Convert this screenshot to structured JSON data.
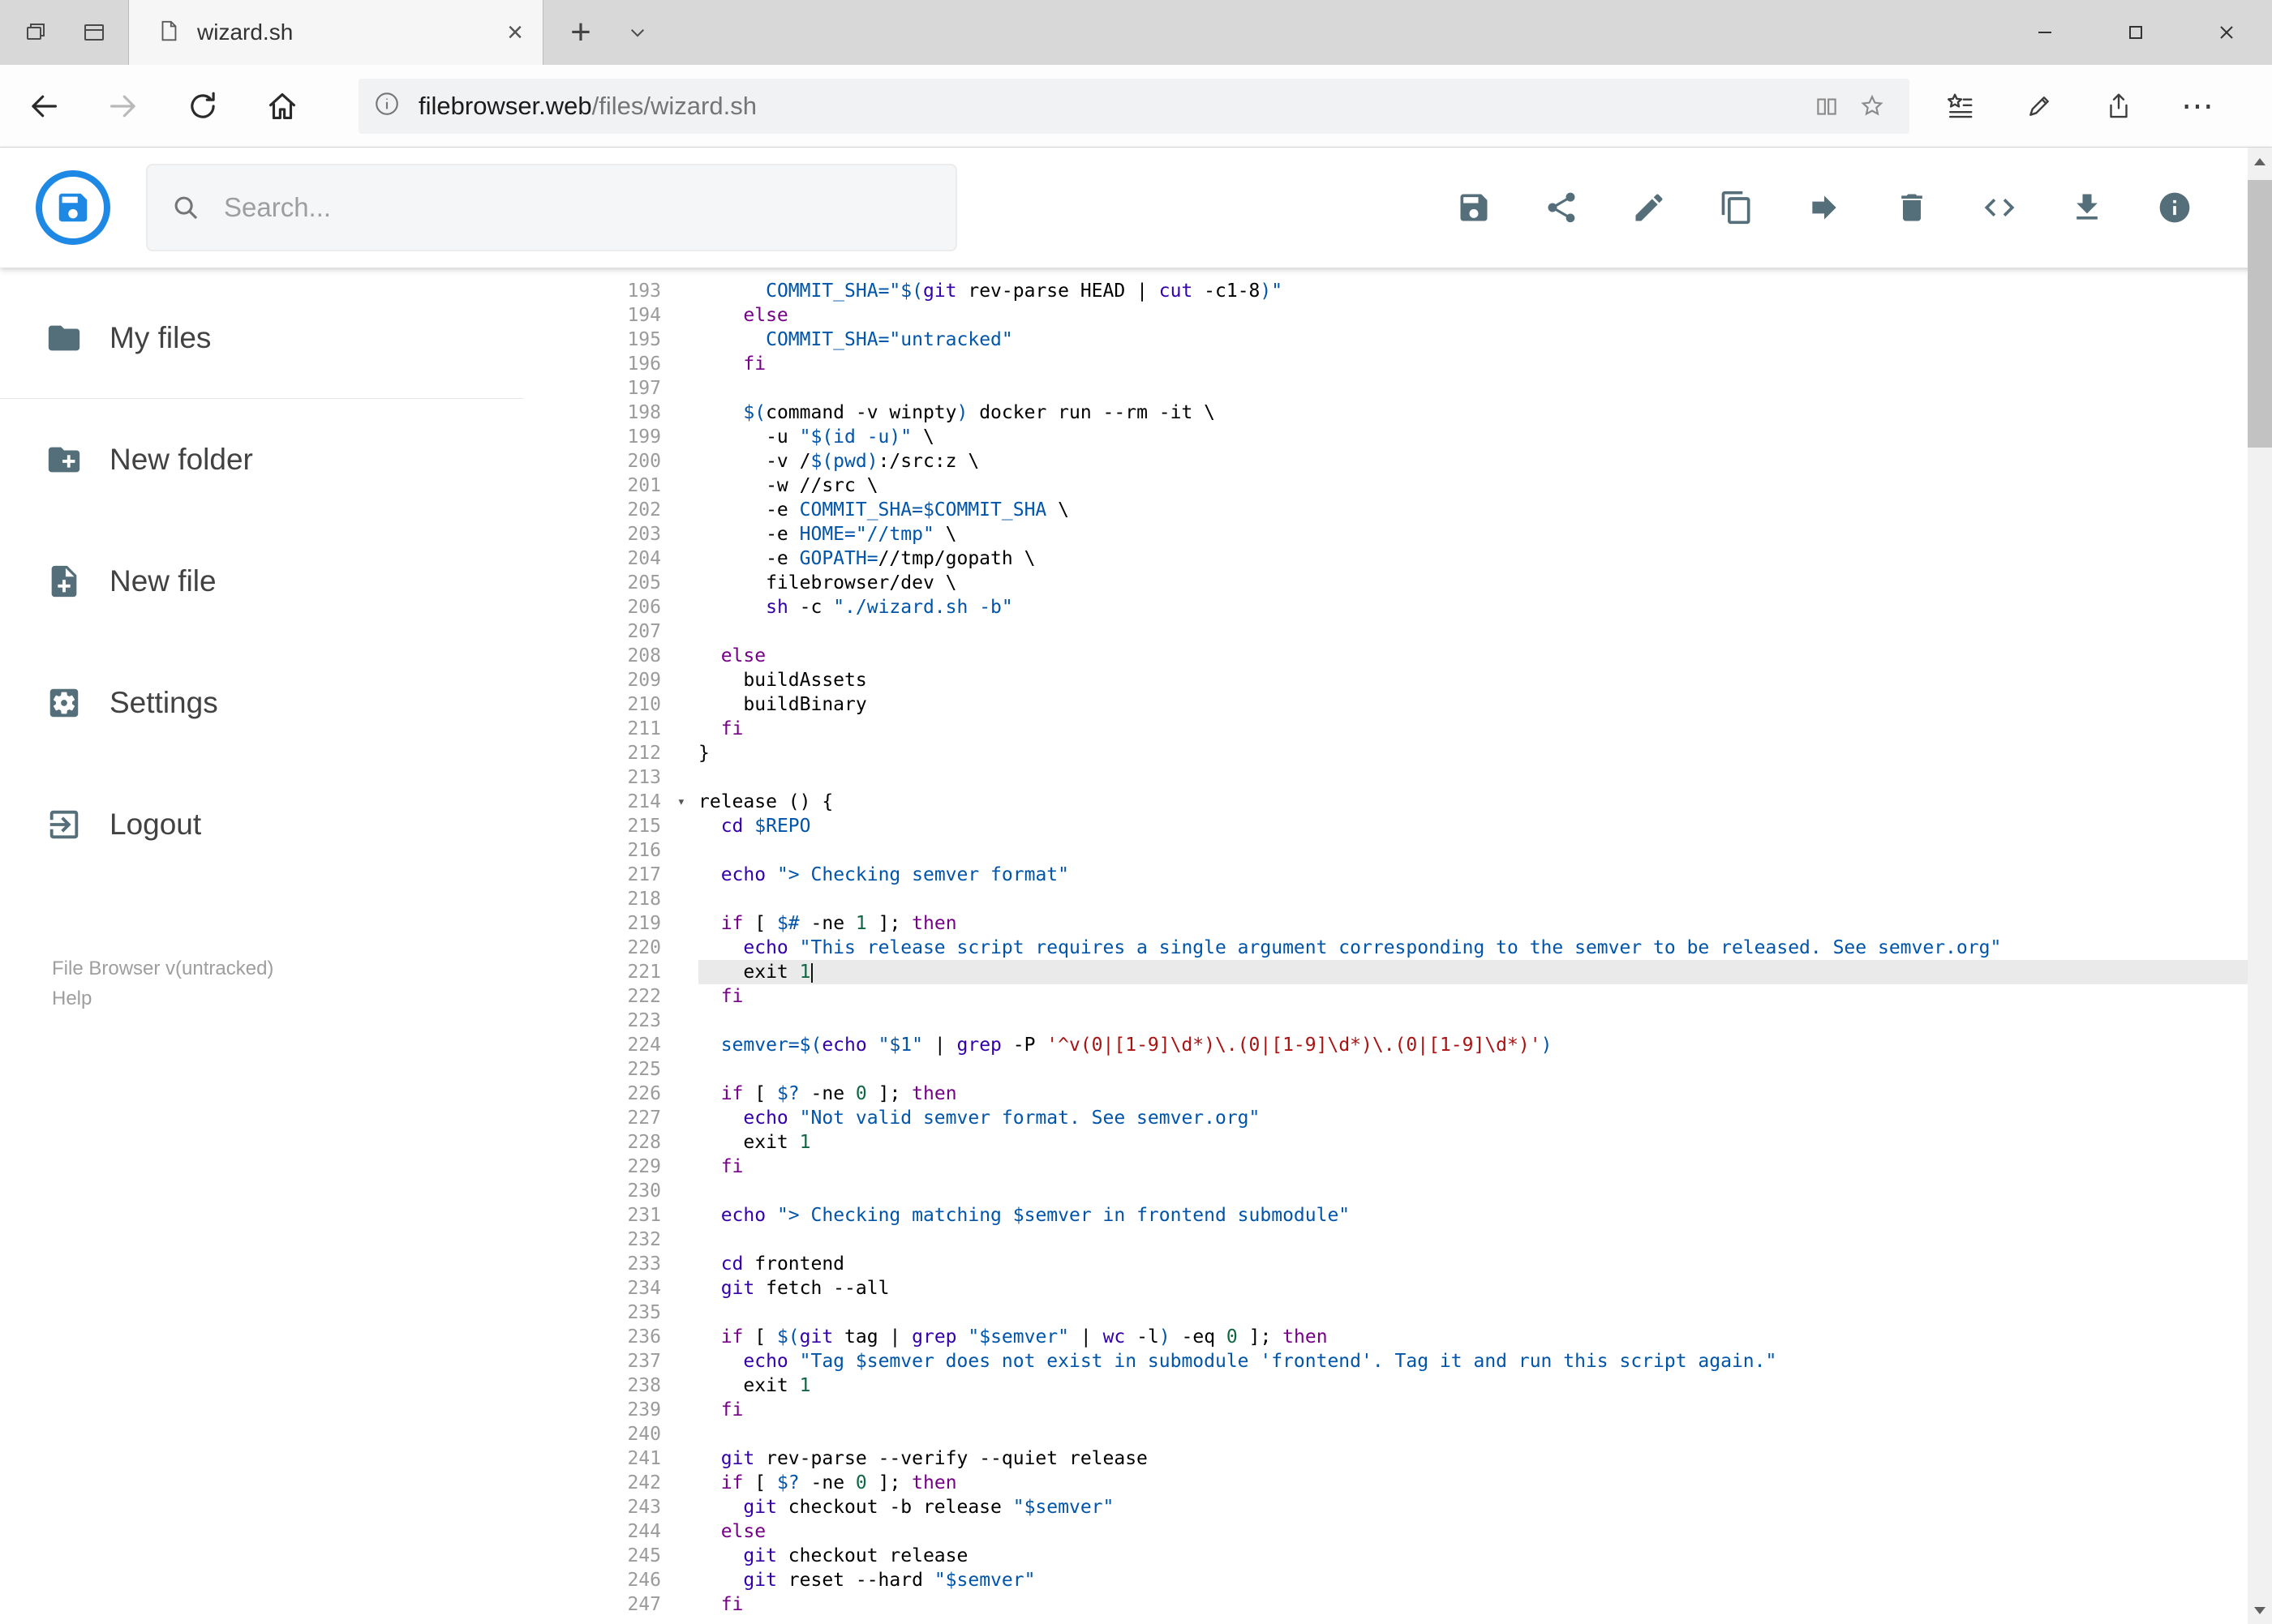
{
  "browser": {
    "tab_title": "wizard.sh",
    "url_domain": "filebrowser.web",
    "url_path": "/files/wizard.sh"
  },
  "glyphs": {
    "close_tab": "×",
    "new_tab": "+",
    "ellipsis": "⋯",
    "fold": "▾"
  },
  "theme": {
    "accent": "#1e88e5",
    "toolbar_icon": "#546e7a",
    "keyword": "#770088",
    "variable": "#0055aa",
    "builtin": "#3300aa",
    "number": "#116644",
    "string_single": "#aa1111",
    "active_line": "#eaeaea"
  },
  "app": {
    "search_placeholder": "Search...",
    "toolbar": [
      {
        "id": "save"
      },
      {
        "id": "share"
      },
      {
        "id": "rename"
      },
      {
        "id": "copy"
      },
      {
        "id": "move"
      },
      {
        "id": "delete"
      },
      {
        "id": "code"
      },
      {
        "id": "download"
      },
      {
        "id": "info"
      }
    ],
    "sidebar": [
      {
        "id": "my-files",
        "label": "My files",
        "icon": "folder"
      },
      {
        "id": "new-folder",
        "label": "New folder",
        "icon": "newfolder"
      },
      {
        "id": "new-file",
        "label": "New file",
        "icon": "newfile"
      },
      {
        "id": "settings",
        "label": "Settings",
        "icon": "settings"
      },
      {
        "id": "logout",
        "label": "Logout",
        "icon": "logout"
      }
    ],
    "footer_version": "File Browser v(untracked)",
    "footer_help": "Help"
  },
  "editor": {
    "active_line": 221,
    "fold_line": 214,
    "lines": [
      {
        "n": 193,
        "seg": [
          [
            "p",
            "      "
          ],
          [
            "v",
            "COMMIT_SHA=\"$("
          ],
          [
            "b",
            "git"
          ],
          [
            "p",
            " rev-parse HEAD | "
          ],
          [
            "b",
            "cut"
          ],
          [
            "p",
            " -c1-8"
          ],
          [
            "v",
            ")\""
          ]
        ]
      },
      {
        "n": 194,
        "seg": [
          [
            "p",
            "    "
          ],
          [
            "k",
            "else"
          ]
        ]
      },
      {
        "n": 195,
        "seg": [
          [
            "p",
            "      "
          ],
          [
            "v",
            "COMMIT_SHA=\"untracked\""
          ]
        ]
      },
      {
        "n": 196,
        "seg": [
          [
            "p",
            "    "
          ],
          [
            "k",
            "fi"
          ]
        ]
      },
      {
        "n": 197,
        "seg": []
      },
      {
        "n": 198,
        "seg": [
          [
            "p",
            "    "
          ],
          [
            "v",
            "$("
          ],
          [
            "p",
            "command -v winpty"
          ],
          [
            "v",
            ")"
          ],
          [
            "p",
            " docker run --rm -it \\"
          ]
        ]
      },
      {
        "n": 199,
        "seg": [
          [
            "p",
            "      -u "
          ],
          [
            "v",
            "\"$(id -u)\""
          ],
          [
            "p",
            " \\"
          ]
        ]
      },
      {
        "n": 200,
        "seg": [
          [
            "p",
            "      -v /"
          ],
          [
            "v",
            "$(pwd)"
          ],
          [
            "p",
            ":/src:z \\"
          ]
        ]
      },
      {
        "n": 201,
        "seg": [
          [
            "p",
            "      -w //src \\"
          ]
        ]
      },
      {
        "n": 202,
        "seg": [
          [
            "p",
            "      -e "
          ],
          [
            "v",
            "COMMIT_SHA=$COMMIT_SHA"
          ],
          [
            "p",
            " \\"
          ]
        ]
      },
      {
        "n": 203,
        "seg": [
          [
            "p",
            "      -e "
          ],
          [
            "v",
            "HOME=\"//tmp\""
          ],
          [
            "p",
            " \\"
          ]
        ]
      },
      {
        "n": 204,
        "seg": [
          [
            "p",
            "      -e "
          ],
          [
            "v",
            "GOPATH="
          ],
          [
            "p",
            "//tmp/gopath \\"
          ]
        ]
      },
      {
        "n": 205,
        "seg": [
          [
            "p",
            "      filebrowser/dev \\"
          ]
        ]
      },
      {
        "n": 206,
        "seg": [
          [
            "p",
            "      "
          ],
          [
            "b",
            "sh"
          ],
          [
            "p",
            " -c "
          ],
          [
            "v",
            "\"./wizard.sh -b\""
          ]
        ]
      },
      {
        "n": 207,
        "seg": []
      },
      {
        "n": 208,
        "seg": [
          [
            "p",
            "  "
          ],
          [
            "k",
            "else"
          ]
        ]
      },
      {
        "n": 209,
        "seg": [
          [
            "p",
            "    buildAssets"
          ]
        ]
      },
      {
        "n": 210,
        "seg": [
          [
            "p",
            "    buildBinary"
          ]
        ]
      },
      {
        "n": 211,
        "seg": [
          [
            "p",
            "  "
          ],
          [
            "k",
            "fi"
          ]
        ]
      },
      {
        "n": 212,
        "seg": [
          [
            "p",
            "}"
          ]
        ]
      },
      {
        "n": 213,
        "seg": []
      },
      {
        "n": 214,
        "seg": [
          [
            "p",
            "release () {"
          ]
        ]
      },
      {
        "n": 215,
        "seg": [
          [
            "p",
            "  "
          ],
          [
            "b",
            "cd"
          ],
          [
            "p",
            " "
          ],
          [
            "v",
            "$REPO"
          ]
        ]
      },
      {
        "n": 216,
        "seg": []
      },
      {
        "n": 217,
        "seg": [
          [
            "p",
            "  "
          ],
          [
            "b",
            "echo"
          ],
          [
            "p",
            " "
          ],
          [
            "v",
            "\"> Checking semver format\""
          ]
        ]
      },
      {
        "n": 218,
        "seg": []
      },
      {
        "n": 219,
        "seg": [
          [
            "p",
            "  "
          ],
          [
            "k",
            "if"
          ],
          [
            "p",
            " [ "
          ],
          [
            "v",
            "$#"
          ],
          [
            "p",
            " -ne "
          ],
          [
            "n",
            "1"
          ],
          [
            "p",
            " ]; "
          ],
          [
            "k",
            "then"
          ]
        ]
      },
      {
        "n": 220,
        "seg": [
          [
            "p",
            "    "
          ],
          [
            "b",
            "echo"
          ],
          [
            "p",
            " "
          ],
          [
            "v",
            "\"This release script requires a single argument corresponding to the semver to be released. See semver.org\""
          ]
        ]
      },
      {
        "n": 221,
        "seg": [
          [
            "p",
            "    exit "
          ],
          [
            "n",
            "1"
          ]
        ]
      },
      {
        "n": 222,
        "seg": [
          [
            "p",
            "  "
          ],
          [
            "k",
            "fi"
          ]
        ]
      },
      {
        "n": 223,
        "seg": []
      },
      {
        "n": 224,
        "seg": [
          [
            "p",
            "  "
          ],
          [
            "v",
            "semver=$("
          ],
          [
            "b",
            "echo"
          ],
          [
            "p",
            " "
          ],
          [
            "v",
            "\"$1\""
          ],
          [
            "p",
            " | "
          ],
          [
            "b",
            "grep"
          ],
          [
            "p",
            " -P "
          ],
          [
            "s",
            "'^v(0|[1-9]\\d*)\\.(0|[1-9]\\d*)\\.(0|[1-9]\\d*)'"
          ],
          [
            "v",
            ")"
          ]
        ]
      },
      {
        "n": 225,
        "seg": []
      },
      {
        "n": 226,
        "seg": [
          [
            "p",
            "  "
          ],
          [
            "k",
            "if"
          ],
          [
            "p",
            " [ "
          ],
          [
            "v",
            "$?"
          ],
          [
            "p",
            " -ne "
          ],
          [
            "n",
            "0"
          ],
          [
            "p",
            " ]; "
          ],
          [
            "k",
            "then"
          ]
        ]
      },
      {
        "n": 227,
        "seg": [
          [
            "p",
            "    "
          ],
          [
            "b",
            "echo"
          ],
          [
            "p",
            " "
          ],
          [
            "v",
            "\"Not valid semver format. See semver.org\""
          ]
        ]
      },
      {
        "n": 228,
        "seg": [
          [
            "p",
            "    exit "
          ],
          [
            "n",
            "1"
          ]
        ]
      },
      {
        "n": 229,
        "seg": [
          [
            "p",
            "  "
          ],
          [
            "k",
            "fi"
          ]
        ]
      },
      {
        "n": 230,
        "seg": []
      },
      {
        "n": 231,
        "seg": [
          [
            "p",
            "  "
          ],
          [
            "b",
            "echo"
          ],
          [
            "p",
            " "
          ],
          [
            "v",
            "\"> Checking matching $semver in frontend submodule\""
          ]
        ]
      },
      {
        "n": 232,
        "seg": []
      },
      {
        "n": 233,
        "seg": [
          [
            "p",
            "  "
          ],
          [
            "b",
            "cd"
          ],
          [
            "p",
            " frontend"
          ]
        ]
      },
      {
        "n": 234,
        "seg": [
          [
            "p",
            "  "
          ],
          [
            "b",
            "git"
          ],
          [
            "p",
            " fetch --all"
          ]
        ]
      },
      {
        "n": 235,
        "seg": []
      },
      {
        "n": 236,
        "seg": [
          [
            "p",
            "  "
          ],
          [
            "k",
            "if"
          ],
          [
            "p",
            " [ "
          ],
          [
            "v",
            "$("
          ],
          [
            "b",
            "git"
          ],
          [
            "p",
            " tag | "
          ],
          [
            "b",
            "grep"
          ],
          [
            "p",
            " "
          ],
          [
            "v",
            "\"$semver\""
          ],
          [
            "p",
            " | "
          ],
          [
            "b",
            "wc"
          ],
          [
            "p",
            " -l"
          ],
          [
            "v",
            ")"
          ],
          [
            "p",
            " -eq "
          ],
          [
            "n",
            "0"
          ],
          [
            "p",
            " ]; "
          ],
          [
            "k",
            "then"
          ]
        ]
      },
      {
        "n": 237,
        "seg": [
          [
            "p",
            "    "
          ],
          [
            "b",
            "echo"
          ],
          [
            "p",
            " "
          ],
          [
            "v",
            "\"Tag $semver does not exist in submodule 'frontend'. Tag it and run this script again.\""
          ]
        ]
      },
      {
        "n": 238,
        "seg": [
          [
            "p",
            "    exit "
          ],
          [
            "n",
            "1"
          ]
        ]
      },
      {
        "n": 239,
        "seg": [
          [
            "p",
            "  "
          ],
          [
            "k",
            "fi"
          ]
        ]
      },
      {
        "n": 240,
        "seg": []
      },
      {
        "n": 241,
        "seg": [
          [
            "p",
            "  "
          ],
          [
            "b",
            "git"
          ],
          [
            "p",
            " rev-parse --verify --quiet release"
          ]
        ]
      },
      {
        "n": 242,
        "seg": [
          [
            "p",
            "  "
          ],
          [
            "k",
            "if"
          ],
          [
            "p",
            " [ "
          ],
          [
            "v",
            "$?"
          ],
          [
            "p",
            " -ne "
          ],
          [
            "n",
            "0"
          ],
          [
            "p",
            " ]; "
          ],
          [
            "k",
            "then"
          ]
        ]
      },
      {
        "n": 243,
        "seg": [
          [
            "p",
            "    "
          ],
          [
            "b",
            "git"
          ],
          [
            "p",
            " checkout -b release "
          ],
          [
            "v",
            "\"$semver\""
          ]
        ]
      },
      {
        "n": 244,
        "seg": [
          [
            "p",
            "  "
          ],
          [
            "k",
            "else"
          ]
        ]
      },
      {
        "n": 245,
        "seg": [
          [
            "p",
            "    "
          ],
          [
            "b",
            "git"
          ],
          [
            "p",
            " checkout release"
          ]
        ]
      },
      {
        "n": 246,
        "seg": [
          [
            "p",
            "    "
          ],
          [
            "b",
            "git"
          ],
          [
            "p",
            " reset --hard "
          ],
          [
            "v",
            "\"$semver\""
          ]
        ]
      },
      {
        "n": 247,
        "seg": [
          [
            "p",
            "  "
          ],
          [
            "k",
            "fi"
          ]
        ]
      }
    ]
  }
}
